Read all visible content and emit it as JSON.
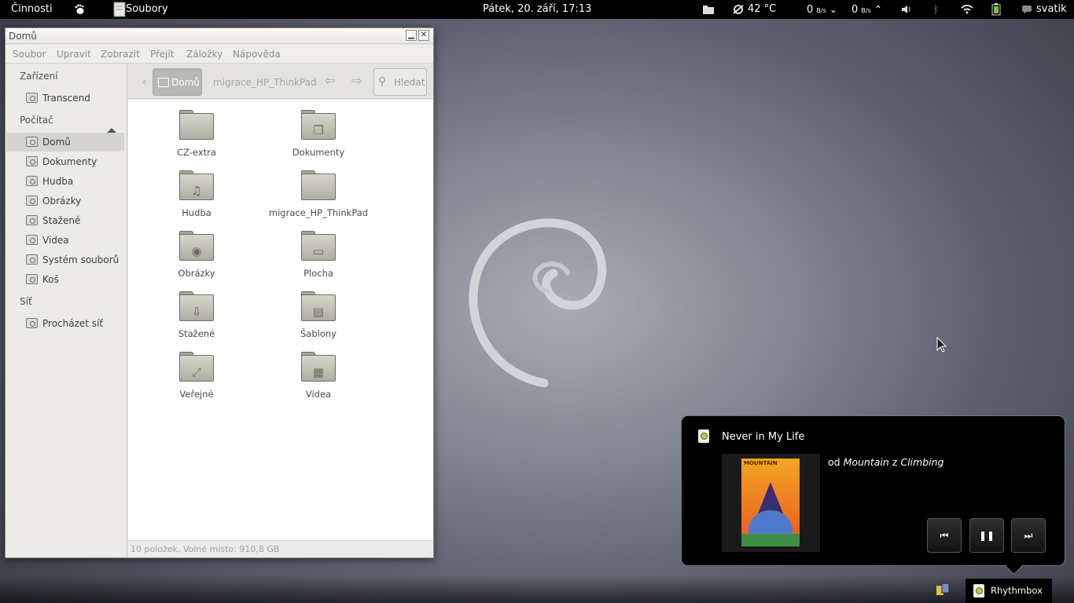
{
  "topbar": {
    "activities": "Činnosti",
    "app_name": "Soubory",
    "clock": "Pátek, 20. září, 17:13",
    "temperature": "42 °C",
    "down_speed": "0",
    "down_unit": "B/s",
    "up_speed": "0",
    "up_unit": "B/s",
    "user": "svatik"
  },
  "window": {
    "title": "Domů",
    "menu": [
      "Soubor",
      "Upravit",
      "Zobrazit",
      "Přejít",
      "Záložky",
      "Nápověda"
    ],
    "sidebar": {
      "devices_header": "Zařízení",
      "devices": [
        {
          "label": "Transcend",
          "icon": "usb-drive-icon"
        }
      ],
      "computer_header": "Počítač",
      "computer": [
        {
          "label": "Domů",
          "icon": "home-folder-icon",
          "active": true
        },
        {
          "label": "Dokumenty",
          "icon": "documents-folder-icon"
        },
        {
          "label": "Hudba",
          "icon": "music-folder-icon"
        },
        {
          "label": "Obrázky",
          "icon": "pictures-folder-icon"
        },
        {
          "label": "Stažené",
          "icon": "downloads-folder-icon"
        },
        {
          "label": "Videa",
          "icon": "videos-folder-icon"
        },
        {
          "label": "Systém souborů",
          "icon": "filesystem-icon"
        },
        {
          "label": "Koš",
          "icon": "trash-icon"
        }
      ],
      "network_header": "Síť",
      "network": [
        {
          "label": "Procházet síť",
          "icon": "network-icon"
        }
      ]
    },
    "toolbar": {
      "crumb_home": "Domů",
      "crumb_next": "migrace_HP_ThinkPad",
      "search_placeholder": "Hledat"
    },
    "files": [
      {
        "label": "CZ-extra",
        "glyph": ""
      },
      {
        "label": "Dokumenty",
        "glyph": "❐"
      },
      {
        "label": "Hudba",
        "glyph": "♫"
      },
      {
        "label": "migrace_HP_ThinkPad",
        "glyph": ""
      },
      {
        "label": "Obrázky",
        "glyph": "◉"
      },
      {
        "label": "Plocha",
        "glyph": "▭"
      },
      {
        "label": "Stažené",
        "glyph": "⇩"
      },
      {
        "label": "Šablony",
        "glyph": "▤"
      },
      {
        "label": "Veřejné",
        "glyph": "⤢"
      },
      {
        "label": "Videa",
        "glyph": "▦"
      }
    ],
    "status": "10 položek, Volné místo: 910,8 GB"
  },
  "notification": {
    "title": "Never in My Life",
    "by": "od",
    "artist": "Mountain",
    "from": "z",
    "album": "Climbing",
    "art_text": "MOUNTAIN",
    "art_sub": "CLIMBING"
  },
  "taskbar": {
    "rhythmbox_label": "Rhythmbox"
  }
}
